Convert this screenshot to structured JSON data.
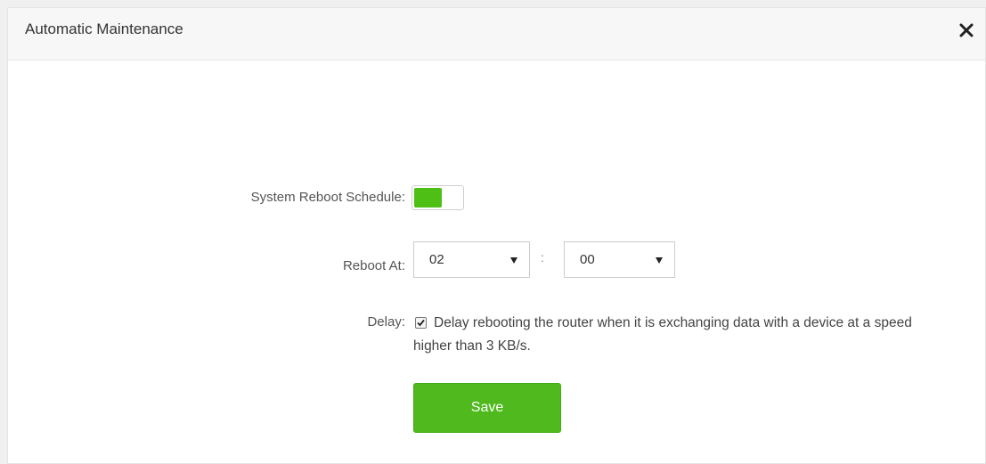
{
  "dialog": {
    "title": "Automatic Maintenance",
    "close_icon": "close-icon"
  },
  "form": {
    "schedule_label": "System Reboot Schedule:",
    "schedule_enabled": true,
    "reboot_label": "Reboot At:",
    "hour_value": "02",
    "time_separator": ":",
    "minute_value": "00",
    "delay_label": "Delay:",
    "delay_checked": true,
    "delay_text": "Delay rebooting the router when it is exchanging data with a device at a speed higher than 3 KB/s.",
    "save_label": "Save"
  },
  "colors": {
    "accent": "#4fb91d",
    "toggle_on": "#4ec015"
  }
}
